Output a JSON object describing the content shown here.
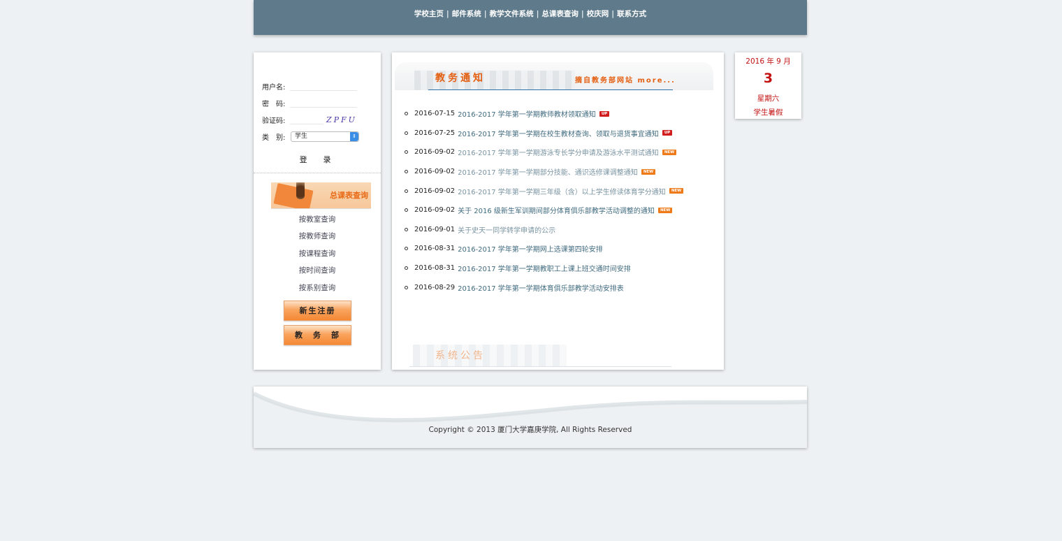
{
  "topnav": {
    "links": [
      "学校主页",
      "邮件系统",
      "教学文件系统",
      "总课表查询",
      "校庆网",
      "联系方式"
    ],
    "separator": "|"
  },
  "login": {
    "username_label": "用户名:",
    "password_label": "密　码:",
    "captcha_label": "验证码:",
    "captcha_text": "ZPFU",
    "category_label": "类　别:",
    "category_value": "学生",
    "login_button": "登　录"
  },
  "schedule": {
    "banner_title": "总课表查询",
    "links": [
      "按教室查询",
      "按教师查询",
      "按课程查询",
      "按时间查询",
      "按系别查询"
    ],
    "buttons": [
      "新生注册",
      "教　务　部"
    ]
  },
  "notices": {
    "heading": "教务通知",
    "more": "摘自教务部网站 more...",
    "items": [
      {
        "date": "2016-07-15",
        "title": "2016-2017 学年第一学期教师教材领取通知",
        "badge": "UP",
        "faded": false
      },
      {
        "date": "2016-07-25",
        "title": "2016-2017 学年第一学期在校生教材查询、领取与退货事宜通知",
        "badge": "UP",
        "faded": false
      },
      {
        "date": "2016-09-02",
        "title": "2016-2017 学年第一学期游泳专长学分申请及游泳水平测试通知",
        "badge": "NEW",
        "faded": true
      },
      {
        "date": "2016-09-02",
        "title": "2016-2017 学年第一学期部分技能、通识选修课调整通知",
        "badge": "NEW",
        "faded": true
      },
      {
        "date": "2016-09-02",
        "title": "2016-2017 学年第一学期三年级（含）以上学生修读体育学分通知",
        "badge": "NEW",
        "faded": true
      },
      {
        "date": "2016-09-02",
        "title": "关于 2016 级新生军训期间部分体育俱乐部教学活动调整的通知",
        "badge": "NEW",
        "faded": false
      },
      {
        "date": "2016-09-01",
        "title": "关于史天一同学转学申请的公示",
        "badge": "",
        "faded": true
      },
      {
        "date": "2016-08-31",
        "title": "2016-2017 学年第一学期网上选课第四轮安排",
        "badge": "",
        "faded": false
      },
      {
        "date": "2016-08-31",
        "title": "2016-2017 学年第一学期教职工上课上班交通时间安排",
        "badge": "",
        "faded": false
      },
      {
        "date": "2016-08-29",
        "title": "2016-2017 学年第一学期体育俱乐部教学活动安排表",
        "badge": "",
        "faded": false
      }
    ],
    "system_heading": "系统公告"
  },
  "calendar": {
    "year_month": "2016 年 9 月",
    "day": "3",
    "weekday": "星期六",
    "term": "学生暑假"
  },
  "footer": {
    "copyright": "Copyright © 2013 厦门大学嘉庚学院, All Rights Reserved"
  }
}
